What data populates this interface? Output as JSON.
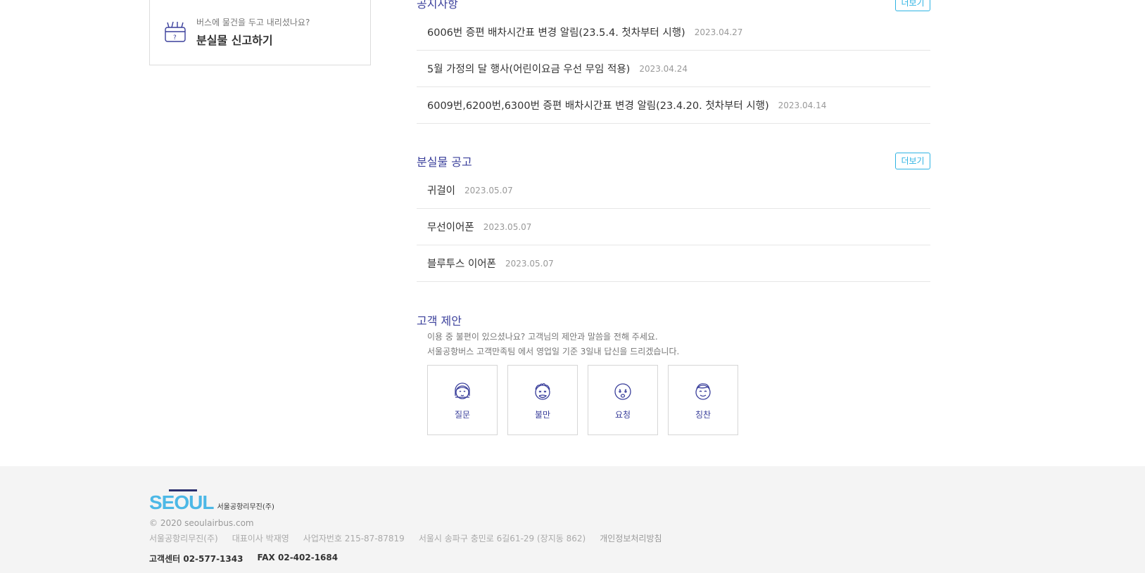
{
  "lost_report": {
    "subtitle": "버스에 물건을 두고 내리셨나요?",
    "title": "분실물 신고하기",
    "icon": "lost-item-box-icon"
  },
  "notice": {
    "title": "공지사항",
    "more_label": "더보기",
    "items": [
      {
        "title": "6006번 증편 배차시간표 변경 알림(23.5.4. 첫차부터 시행)",
        "date": "2023.04.27"
      },
      {
        "title": "5월 가정의 달 행사(어린이요금 우선 무임 적용)",
        "date": "2023.04.24"
      },
      {
        "title": "6009번,6200번,6300번 증편 배차시간표 변경 알림(23.4.20. 첫차부터 시행)",
        "date": "2023.04.14"
      }
    ]
  },
  "lost_notice": {
    "title": "분실물 공고",
    "more_label": "더보기",
    "items": [
      {
        "title": "귀걸이",
        "date": "2023.05.07"
      },
      {
        "title": "무선이어폰",
        "date": "2023.05.07"
      },
      {
        "title": "블루투스 이어폰",
        "date": "2023.05.07"
      }
    ]
  },
  "suggestion": {
    "title": "고객 제안",
    "desc_line1": "이용 중 불편이 있으셨나요? 고객님의 제안과 말씀을 전해 주세요.",
    "desc_line2": "서울공항버스 고객만족팀 에서 영업일 기준 3일내 답신을 드리겠습니다.",
    "buttons": [
      {
        "label": "질문",
        "icon": "question-face-icon"
      },
      {
        "label": "불만",
        "icon": "complaint-face-icon"
      },
      {
        "label": "요청",
        "icon": "request-face-icon"
      },
      {
        "label": "칭찬",
        "icon": "praise-face-icon"
      }
    ]
  },
  "footer": {
    "logo_word": "SEOUL",
    "logo_sub": "서울공항리무진(주)",
    "copyright": "© 2020 seoulairbus.com",
    "company": "서울공항리무진(주)",
    "ceo": "대표이사 박재영",
    "biz_no": "사업자번호 215-87-87819",
    "address": "서울시 송파구 충민로 6길61-29 (장지동 862)",
    "privacy": "개인정보처리방침",
    "cs_center": "고객센터  02-577-1343",
    "fax": "FAX  02-402-1684"
  },
  "colors": {
    "accent_navy": "#3a3f9b",
    "accent_sky": "#2fb3e3",
    "logo_blue": "#4cb8e6"
  }
}
